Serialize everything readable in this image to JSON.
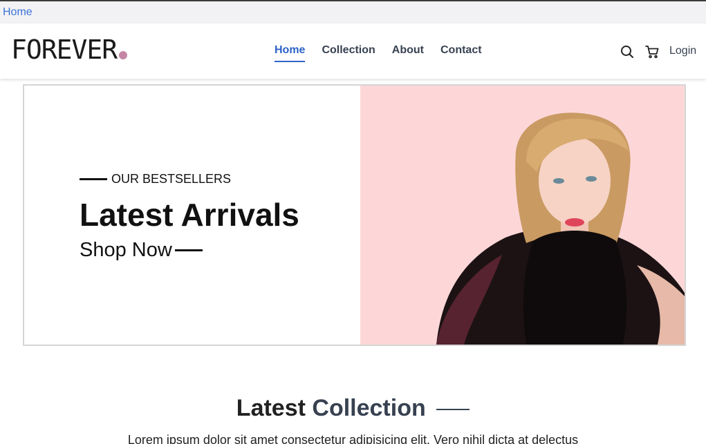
{
  "tab": {
    "crumb": "Home"
  },
  "brand": {
    "name": "FOREVER",
    "dot_color": "#c586a5"
  },
  "nav": {
    "items": [
      "Home",
      "Collection",
      "About",
      "Contact"
    ],
    "active": "Home"
  },
  "header": {
    "login": "Login"
  },
  "icons": {
    "search": "search-icon",
    "cart": "cart-icon"
  },
  "hero": {
    "kicker": "OUR BESTSELLERS",
    "title": "Latest Arrivals",
    "cta": "Shop Now",
    "image_bg": "#fdd7d8"
  },
  "section": {
    "title_part1": "Latest",
    "title_part2": "Collection",
    "description": "Lorem ipsum dolor sit amet consectetur adipisicing elit. Vero nihil dicta at delectus"
  }
}
